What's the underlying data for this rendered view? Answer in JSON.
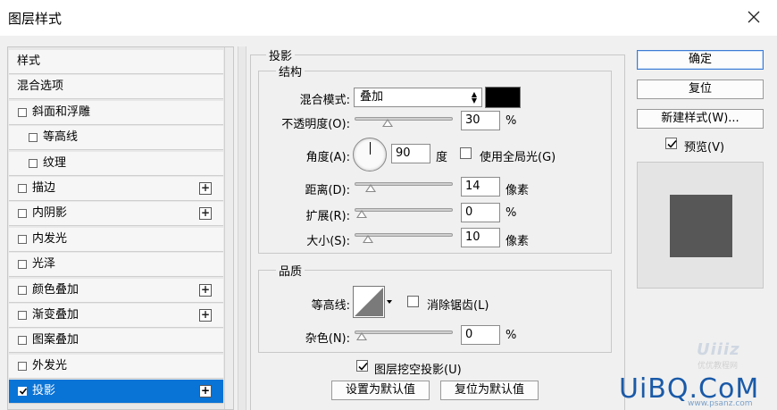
{
  "window": {
    "title": "图层样式"
  },
  "left_list": {
    "items": [
      {
        "label": "样式",
        "checkbox": false,
        "checked": false,
        "plus": false,
        "indent": 0,
        "selected": false
      },
      {
        "label": "混合选项",
        "checkbox": false,
        "checked": false,
        "plus": false,
        "indent": 0,
        "selected": false
      },
      {
        "label": "斜面和浮雕",
        "checkbox": true,
        "checked": false,
        "plus": false,
        "indent": 0,
        "selected": false
      },
      {
        "label": "等高线",
        "checkbox": true,
        "checked": false,
        "plus": false,
        "indent": 1,
        "selected": false
      },
      {
        "label": "纹理",
        "checkbox": true,
        "checked": false,
        "plus": false,
        "indent": 1,
        "selected": false
      },
      {
        "label": "描边",
        "checkbox": true,
        "checked": false,
        "plus": true,
        "indent": 0,
        "selected": false
      },
      {
        "label": "内阴影",
        "checkbox": true,
        "checked": false,
        "plus": true,
        "indent": 0,
        "selected": false
      },
      {
        "label": "内发光",
        "checkbox": true,
        "checked": false,
        "plus": false,
        "indent": 0,
        "selected": false
      },
      {
        "label": "光泽",
        "checkbox": true,
        "checked": false,
        "plus": false,
        "indent": 0,
        "selected": false
      },
      {
        "label": "颜色叠加",
        "checkbox": true,
        "checked": false,
        "plus": true,
        "indent": 0,
        "selected": false
      },
      {
        "label": "渐变叠加",
        "checkbox": true,
        "checked": false,
        "plus": true,
        "indent": 0,
        "selected": false
      },
      {
        "label": "图案叠加",
        "checkbox": true,
        "checked": false,
        "plus": false,
        "indent": 0,
        "selected": false
      },
      {
        "label": "外发光",
        "checkbox": true,
        "checked": false,
        "plus": false,
        "indent": 0,
        "selected": false
      },
      {
        "label": "投影",
        "checkbox": true,
        "checked": true,
        "plus": true,
        "indent": 0,
        "selected": true
      }
    ]
  },
  "drop_shadow": {
    "section_title": "投影",
    "structure": {
      "title": "结构",
      "blend_mode_label": "混合模式:",
      "blend_mode_value": "叠加",
      "shadow_color": "#000000",
      "opacity_label": "不透明度(O):",
      "opacity_value": "30",
      "opacity_unit": "%",
      "opacity_level": 30,
      "angle_label": "角度(A):",
      "angle_value": "90",
      "angle_unit": "度",
      "global_light_label": "使用全局光(G)",
      "global_light_checked": false,
      "distance_label": "距离(D):",
      "distance_value": "14",
      "distance_unit": "像素",
      "distance_level": 0.1,
      "spread_label": "扩展(R):",
      "spread_value": "0",
      "spread_unit": "%",
      "spread_level": 0,
      "size_label": "大小(S):",
      "size_value": "10",
      "size_unit": "像素",
      "size_level": 0.07
    },
    "quality": {
      "title": "品质",
      "contour_label": "等高线:",
      "anti_alias_label": "消除锯齿(L)",
      "anti_alias_checked": false,
      "noise_label": "杂色(N):",
      "noise_value": "0",
      "noise_unit": "%",
      "noise_level": 0
    },
    "knockout_label": "图层挖空投影(U)",
    "knockout_checked": true,
    "make_default_label": "设置为默认值",
    "reset_default_label": "复位为默认值"
  },
  "right_buttons": {
    "ok_label": "确定",
    "reset_label": "复位",
    "new_style_label": "新建样式(W)...",
    "preview_label": "预览(V)",
    "preview_checked": true
  },
  "watermark": {
    "logo_text": "Uiiiz",
    "logo_sub": "优优教程网",
    "brand_text": "UiBQ.CoM",
    "brand_url": "www.psanz.com"
  },
  "colors": {
    "selection": "#0a73d6",
    "preview_square": "#575757"
  }
}
